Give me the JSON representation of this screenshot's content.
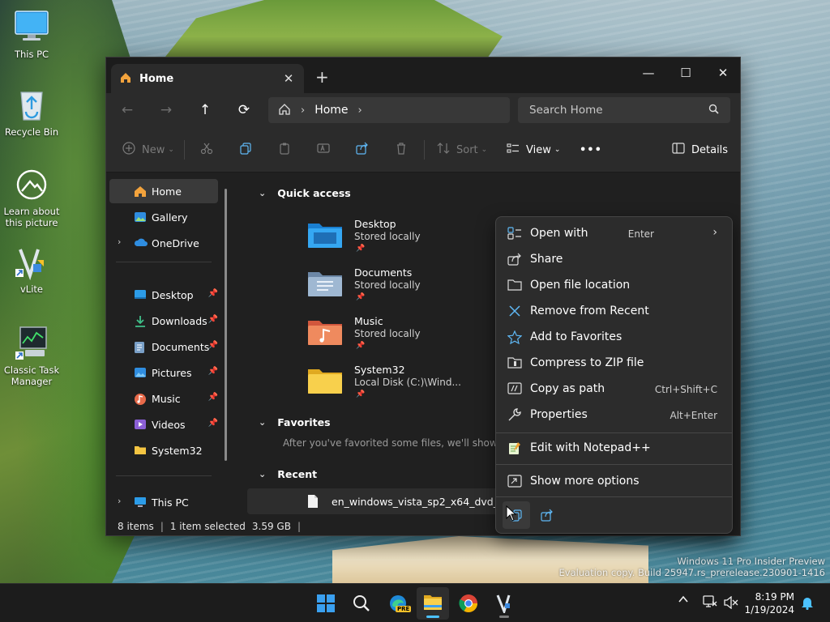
{
  "desktop": {
    "icons": [
      {
        "label": "This PC"
      },
      {
        "label": "Recycle Bin"
      },
      {
        "label": "Learn about this picture"
      },
      {
        "label": "vLite"
      },
      {
        "label": "Classic Task Manager"
      }
    ],
    "watermark": {
      "line1": "Windows 11 Pro Insider Preview",
      "line2": "Evaluation copy. Build 25947.rs_prerelease.230901-1416"
    }
  },
  "explorer": {
    "tab_title": "Home",
    "tab_close_glyph": "✕",
    "new_tab_glyph": "+",
    "window_controls": {
      "minimize": "—",
      "maximize": "☐",
      "close": "✕"
    },
    "address": {
      "crumb": "Home"
    },
    "search": {
      "placeholder": "Search Home"
    },
    "commands": {
      "new": "New",
      "sort": "Sort",
      "view": "View",
      "more": "•••",
      "details": "Details"
    },
    "nav": {
      "home": "Home",
      "gallery": "Gallery",
      "onedrive": "OneDrive",
      "pinned": [
        {
          "label": "Desktop"
        },
        {
          "label": "Downloads"
        },
        {
          "label": "Documents"
        },
        {
          "label": "Pictures"
        },
        {
          "label": "Music"
        },
        {
          "label": "Videos"
        },
        {
          "label": "System32"
        }
      ],
      "thispc": "This PC"
    },
    "quick_access": {
      "title": "Quick access",
      "items": [
        {
          "name": "Desktop",
          "sub": "Stored locally"
        },
        {
          "name": "Documents",
          "sub": "Stored locally"
        },
        {
          "name": "Music",
          "sub": "Stored locally"
        },
        {
          "name": "System32",
          "sub": "Local Disk (C:)\\Wind..."
        }
      ]
    },
    "favorites": {
      "title": "Favorites",
      "hint": "After you've favorited some files, we'll show them"
    },
    "recent": {
      "title": "Recent",
      "items": [
        {
          "name": "en_windows_vista_sp2_x64_dvd_3..."
        }
      ]
    },
    "status": {
      "count": "8 items",
      "selected": "1 item selected",
      "size": "3.59 GB"
    }
  },
  "context_menu": {
    "items": [
      {
        "label": "Open with",
        "accel": "Enter"
      },
      {
        "label": "Share",
        "accel": ""
      },
      {
        "label": "Open file location",
        "accel": ""
      },
      {
        "label": "Remove from Recent",
        "accel": ""
      },
      {
        "label": "Add to Favorites",
        "accel": ""
      },
      {
        "label": "Compress to ZIP file",
        "accel": ""
      },
      {
        "label": "Copy as path",
        "accel": "Ctrl+Shift+C"
      },
      {
        "label": "Properties",
        "accel": "Alt+Enter"
      },
      {
        "label": "Edit with Notepad++",
        "accel": ""
      },
      {
        "label": "Show more options",
        "accel": ""
      }
    ]
  },
  "taskbar": {
    "time": "8:19 PM",
    "date": "1/19/2024",
    "edge_badge": "PRE"
  },
  "colors": {
    "accent": "#4cc2ff",
    "folder_yellow": "#f4c542",
    "window_bg": "#202020"
  }
}
